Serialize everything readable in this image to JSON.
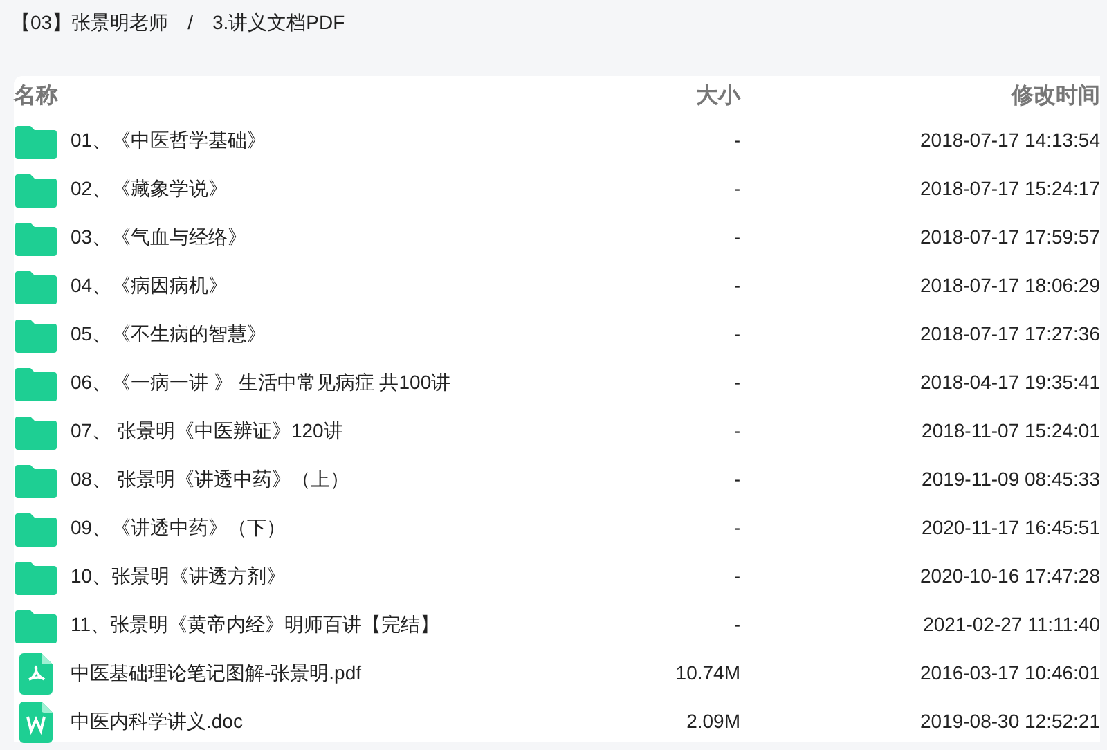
{
  "breadcrumb": [
    {
      "label": "【03】张景明老师"
    },
    {
      "label": "3.讲义文档PDF"
    }
  ],
  "breadcrumb_separator": "/",
  "table": {
    "columns": [
      "名称",
      "大小",
      "修改时间"
    ],
    "rows": [
      {
        "kind": "folder",
        "name": "01、《中医哲学基础》",
        "size": "-",
        "modified": "2018-07-17 14:13:54"
      },
      {
        "kind": "folder",
        "name": "02、《藏象学说》",
        "size": "-",
        "modified": "2018-07-17 15:24:17"
      },
      {
        "kind": "folder",
        "name": "03、《气血与经络》",
        "size": "-",
        "modified": "2018-07-17 17:59:57"
      },
      {
        "kind": "folder",
        "name": "04、《病因病机》",
        "size": "-",
        "modified": "2018-07-17 18:06:29"
      },
      {
        "kind": "folder",
        "name": "05、《不生病的智慧》",
        "size": "-",
        "modified": "2018-07-17 17:27:36"
      },
      {
        "kind": "folder",
        "name": "06、《一病一讲 》 生活中常见病症 共100讲",
        "size": "-",
        "modified": "2018-04-17 19:35:41"
      },
      {
        "kind": "folder",
        "name": "07、 张景明《中医辨证》120讲",
        "size": "-",
        "modified": "2018-11-07 15:24:01"
      },
      {
        "kind": "folder",
        "name": "08、 张景明《讲透中药》（上）",
        "size": "-",
        "modified": "2019-11-09 08:45:33"
      },
      {
        "kind": "folder",
        "name": "09、《讲透中药》（下）",
        "size": "-",
        "modified": "2020-11-17 16:45:51"
      },
      {
        "kind": "folder",
        "name": "10、张景明《讲透方剂》",
        "size": "-",
        "modified": "2020-10-16 17:47:28"
      },
      {
        "kind": "folder",
        "name": "11、张景明《黄帝内经》明师百讲【完结】",
        "size": "-",
        "modified": "2021-02-27 11:11:40"
      },
      {
        "kind": "pdf",
        "name": "中医基础理论笔记图解-张景明.pdf",
        "size": "10.74M",
        "modified": "2016-03-17 10:46:01"
      },
      {
        "kind": "doc",
        "name": "中医内科学讲义.doc",
        "size": "2.09M",
        "modified": "2019-08-30 12:52:21"
      }
    ]
  }
}
